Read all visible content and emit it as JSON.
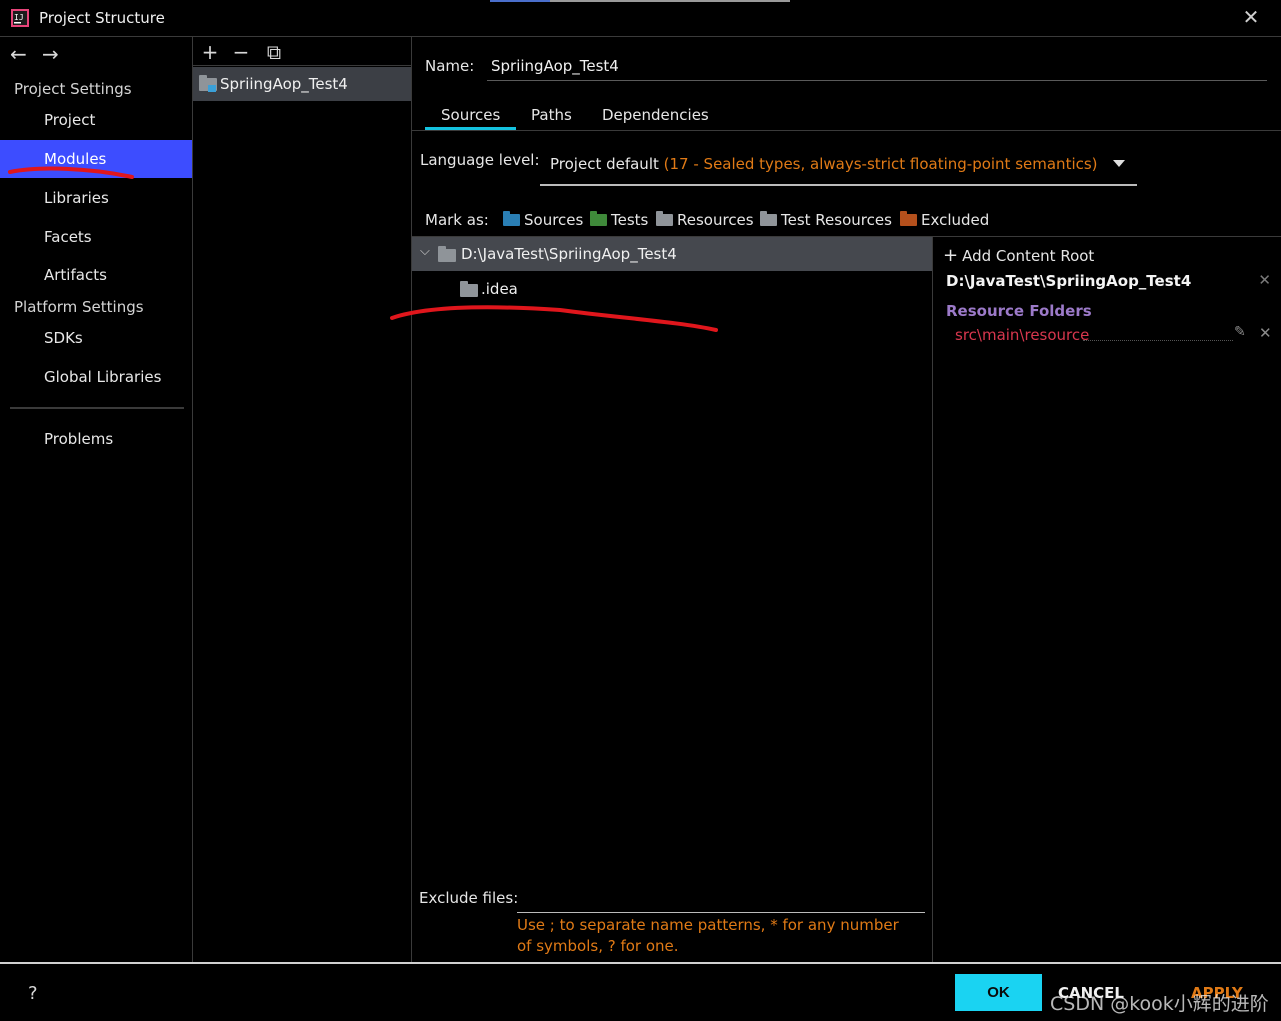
{
  "window": {
    "title": "Project Structure",
    "close_icon": "close-icon"
  },
  "nav": {
    "back_icon": "arrow-left-icon",
    "forward_icon": "arrow-right-icon",
    "sections": [
      {
        "label": "Project Settings"
      },
      {
        "label": "Platform Settings"
      }
    ],
    "items": [
      {
        "label": "Project"
      },
      {
        "label": "Modules"
      },
      {
        "label": "Libraries"
      },
      {
        "label": "Facets"
      },
      {
        "label": "Artifacts"
      },
      {
        "label": "SDKs"
      },
      {
        "label": "Global Libraries"
      },
      {
        "label": "Problems"
      }
    ],
    "selected": "Modules"
  },
  "modules": {
    "toolbar": [
      "+",
      "−",
      "⧉"
    ],
    "list": [
      {
        "name": "SpriingAop_Test4"
      }
    ]
  },
  "module_detail": {
    "name_label": "Name:",
    "name_value": "SpriingAop_Test4",
    "tabs": [
      {
        "label": "Sources"
      },
      {
        "label": "Paths"
      },
      {
        "label": "Dependencies"
      }
    ],
    "active_tab": "Sources",
    "language_level_label": "Language level:",
    "language_level_value": "Project default",
    "language_level_hint": "(17 - Sealed types, always-strict floating-point semantics)",
    "mark_as_label": "Mark as:",
    "mark_as": [
      {
        "label": "Sources",
        "color": "#2a7fb5"
      },
      {
        "label": "Tests",
        "color": "#3f8a3a"
      },
      {
        "label": "Resources",
        "color": "#8f9499"
      },
      {
        "label": "Test Resources",
        "color": "#8f9499"
      },
      {
        "label": "Excluded",
        "color": "#b4501c"
      }
    ],
    "tree": {
      "root": "D:\\JavaTest\\SpriingAop_Test4",
      "children": [
        ".idea"
      ]
    },
    "exclude_files_label": "Exclude files:",
    "exclude_hint": "Use ; to separate name patterns, * for any number of symbols, ? for one."
  },
  "content_root": {
    "add_label": "Add Content Root",
    "path": "D:\\JavaTest\\SpriingAop_Test4",
    "resource_folders_title": "Resource Folders",
    "resource_folders": [
      "src\\main\\resource"
    ]
  },
  "footer": {
    "help": "?",
    "ok": "OK",
    "cancel": "CANCEL",
    "apply": "APPLY",
    "watermark": "CSDN @kook小辉的进阶"
  },
  "colors": {
    "accent": "#1ad3f2",
    "selection": "#3d4dff",
    "warning_text": "#e07a16",
    "resource_title": "#9c7ac9",
    "resource_item": "#d8374e",
    "annotation": "#e0161c"
  }
}
